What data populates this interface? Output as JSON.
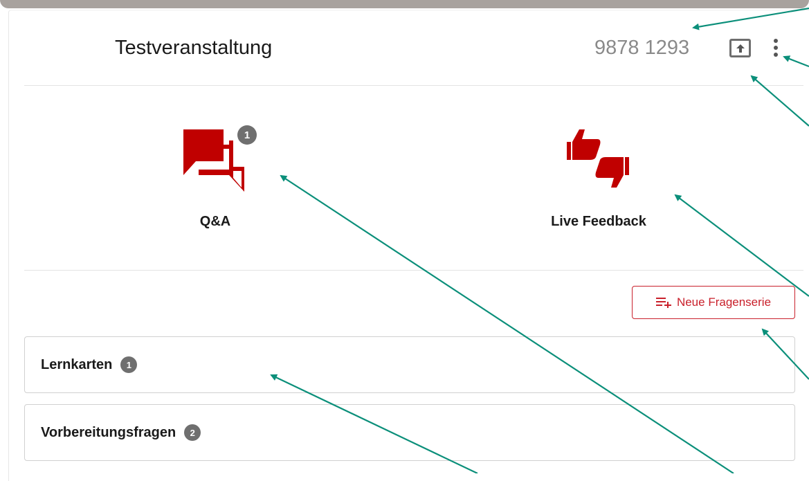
{
  "header": {
    "title": "Testveranstaltung",
    "room_code": "9878 1293"
  },
  "tiles": [
    {
      "label": "Q&A",
      "icon": "chat-bubbles-icon",
      "badge": "1"
    },
    {
      "label": "Live Feedback",
      "icon": "thumbs-feedback-icon"
    }
  ],
  "actions": {
    "new_series_label": "Neue Fragenserie"
  },
  "series": [
    {
      "label": "Lernkarten",
      "badge": "1"
    },
    {
      "label": "Vorbereitungsfragen",
      "badge": "2"
    }
  ],
  "colors": {
    "accent": "#c9202b",
    "icon_red": "#c00000",
    "badge": "#6f6f6f",
    "annotation_arrow": "#0b8f7a"
  }
}
